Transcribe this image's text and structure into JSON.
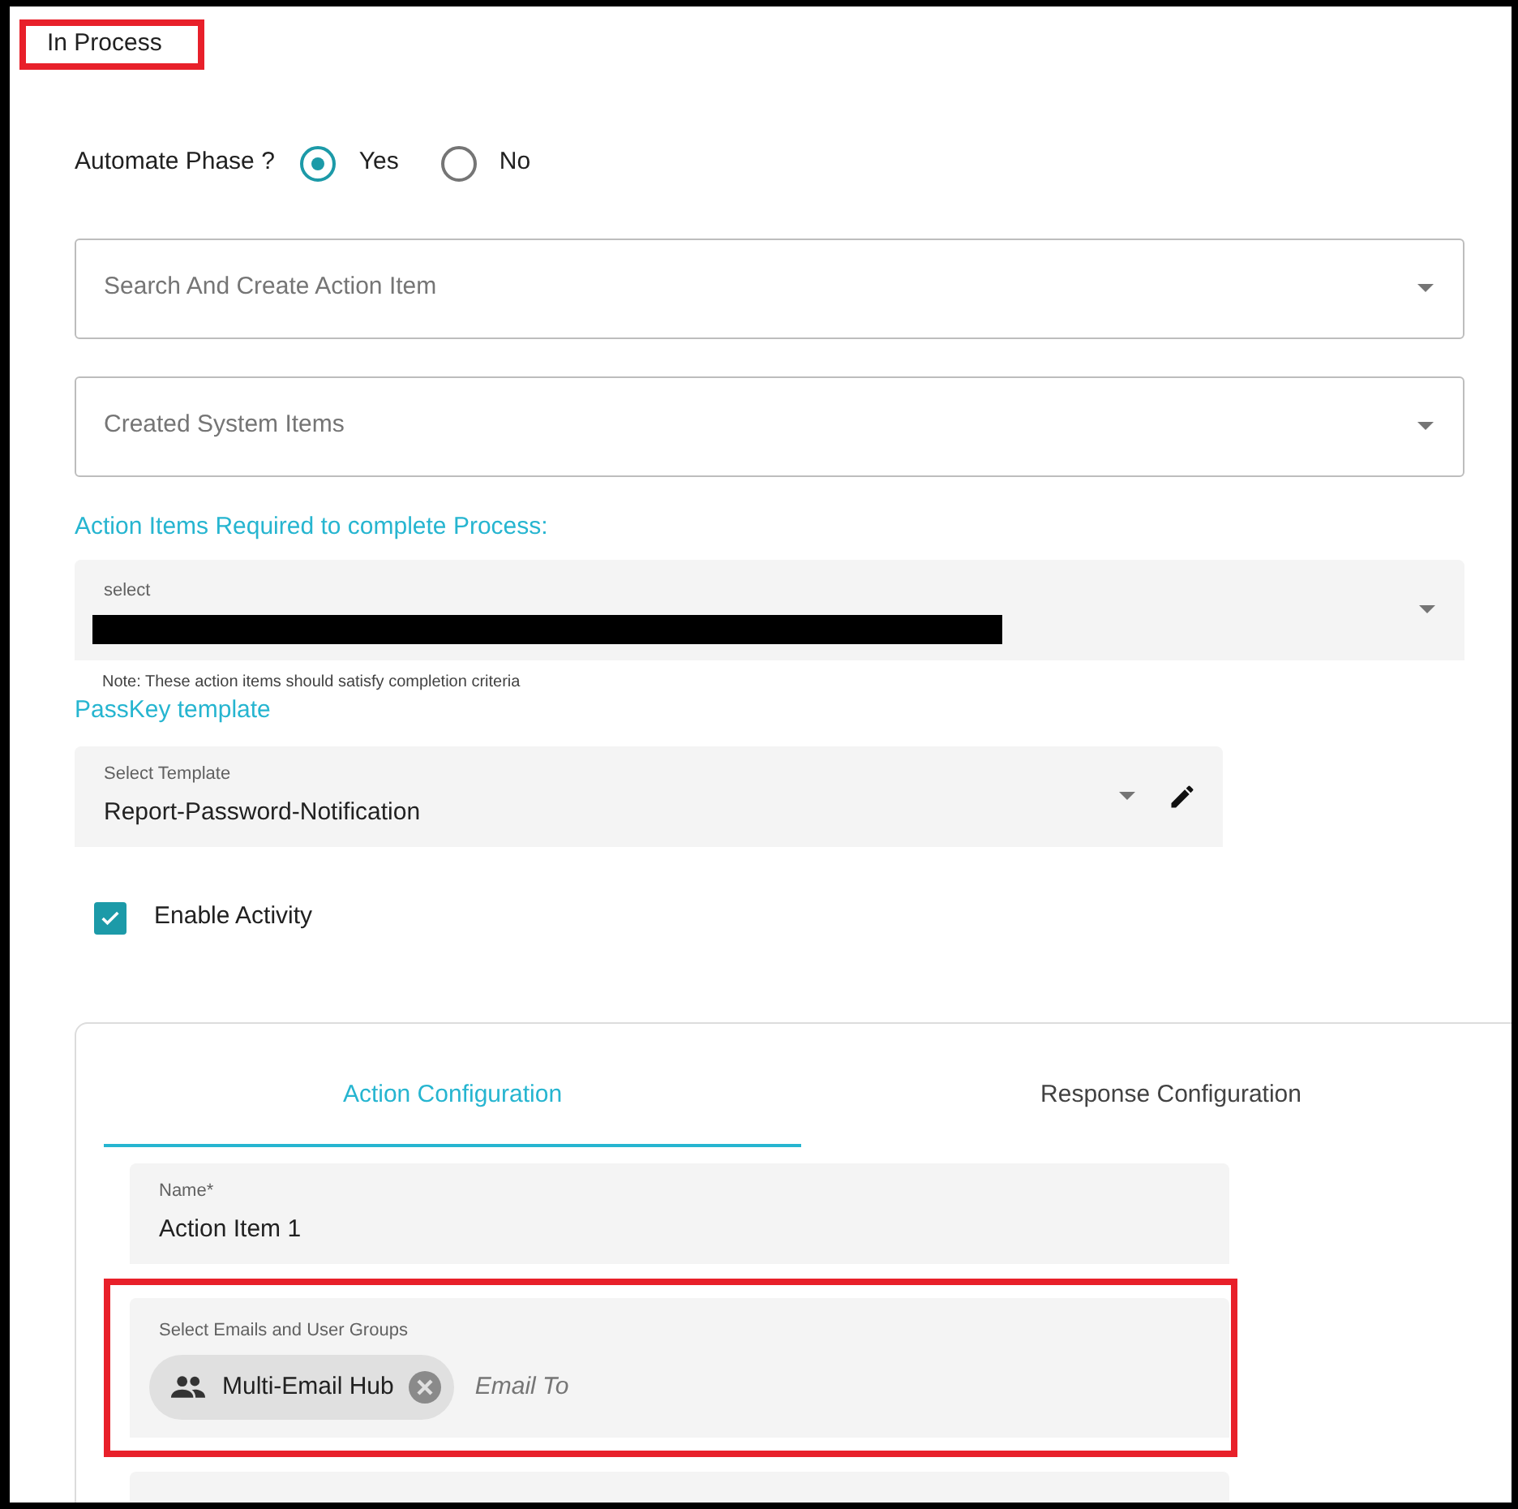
{
  "header": {
    "title": "In Process",
    "highlighted": true
  },
  "automate": {
    "label": "Automate Phase ?",
    "options": [
      {
        "label": "Yes",
        "selected": true
      },
      {
        "label": "No",
        "selected": false
      }
    ]
  },
  "dropdowns": [
    {
      "placeholder": "Search And Create Action Item"
    },
    {
      "placeholder": "Created System Items"
    }
  ],
  "required_section": {
    "title": "Action Items Required to complete Process:",
    "field": {
      "label": "select",
      "redacted": true
    },
    "note": "Note: These action items should satisfy completion criteria"
  },
  "passkey": {
    "title": "PassKey template",
    "field": {
      "label": "Select Template",
      "value": "Report-Password-Notification"
    }
  },
  "enable_activity": {
    "label": "Enable Activity",
    "checked": true
  },
  "tabs": [
    {
      "label": "Action Configuration",
      "selected": true
    },
    {
      "label": "Response Configuration",
      "selected": false
    }
  ],
  "name_field": {
    "label": "Name*",
    "value": "Action Item 1"
  },
  "recipients_field": {
    "label": "Select Emails and User Groups",
    "highlighted": true,
    "chips": [
      {
        "label": "Multi-Email Hub"
      }
    ],
    "placeholder": "Email To"
  }
}
